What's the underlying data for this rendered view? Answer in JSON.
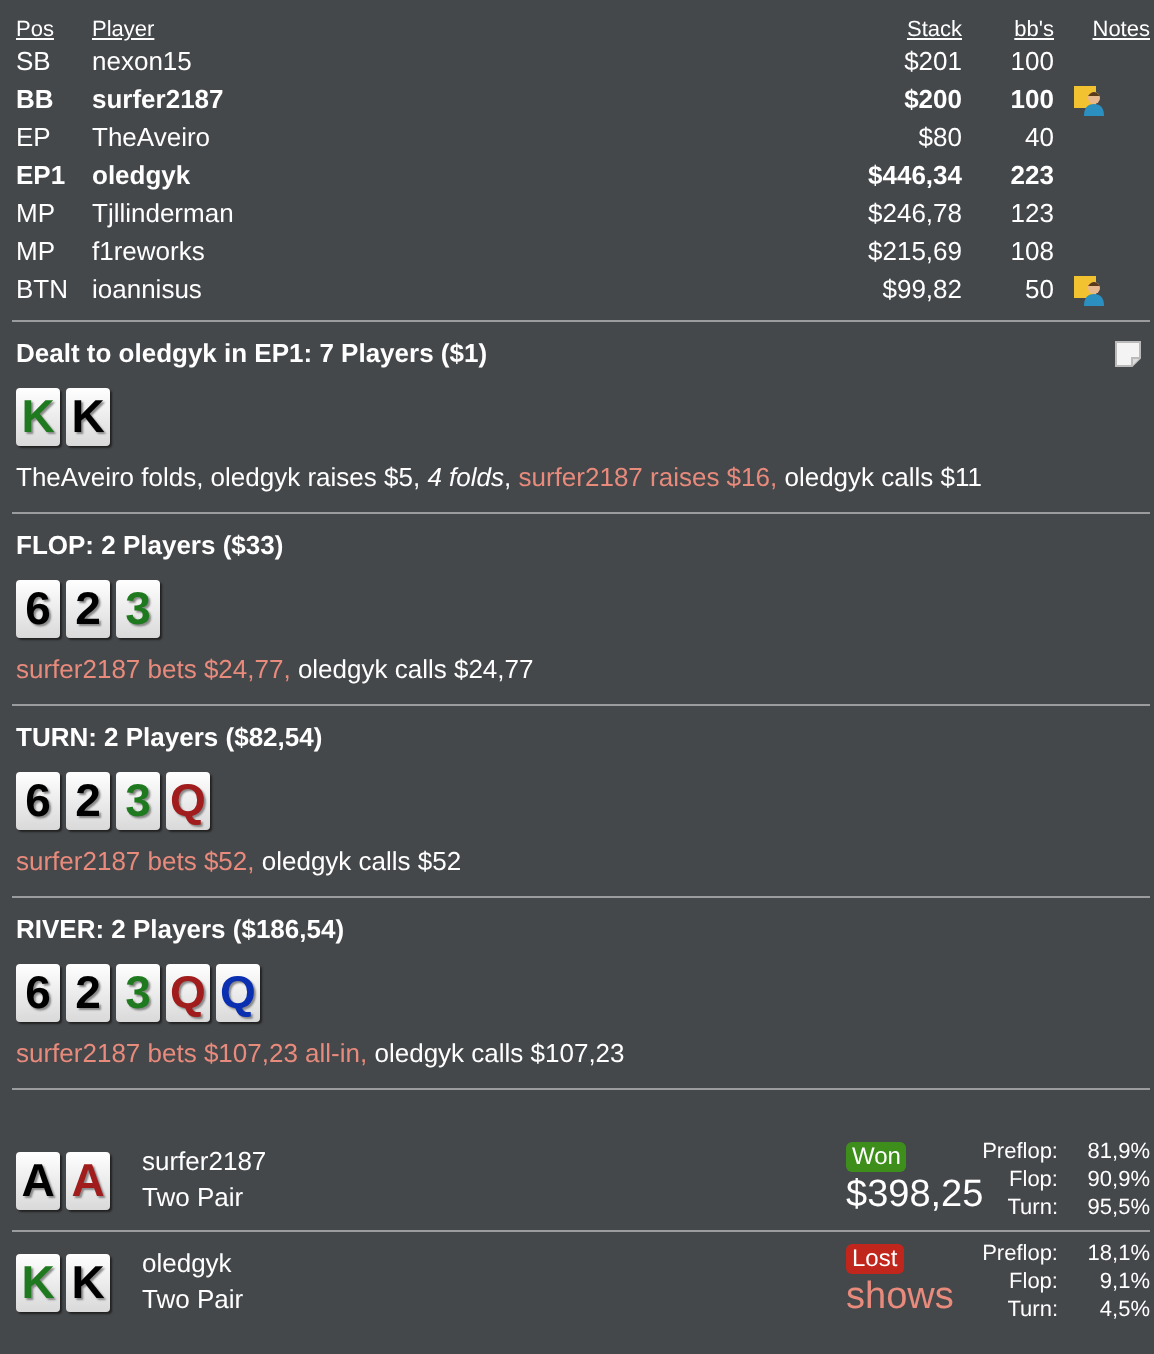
{
  "players": {
    "columns": [
      "Pos",
      "Player",
      "Stack",
      "bb's",
      "Notes"
    ],
    "rows": [
      {
        "pos": "SB",
        "name": "nexon15",
        "stack": "$201",
        "bbs": "100",
        "bold": false,
        "has_note": false
      },
      {
        "pos": "BB",
        "name": "surfer2187",
        "stack": "$200",
        "bbs": "100",
        "bold": true,
        "has_note": true
      },
      {
        "pos": "EP",
        "name": "TheAveiro",
        "stack": "$80",
        "bbs": "40",
        "bold": false,
        "has_note": false
      },
      {
        "pos": "EP1",
        "name": "oledgyk",
        "stack": "$446,34",
        "bbs": "223",
        "bold": true,
        "has_note": false
      },
      {
        "pos": "MP",
        "name": "Tjllinderman",
        "stack": "$246,78",
        "bbs": "123",
        "bold": false,
        "has_note": false
      },
      {
        "pos": "MP",
        "name": "f1reworks",
        "stack": "$215,69",
        "bbs": "108",
        "bold": false,
        "has_note": false
      },
      {
        "pos": "BTN",
        "name": "ioannisus",
        "stack": "$99,82",
        "bbs": "50",
        "bold": false,
        "has_note": true
      }
    ]
  },
  "streets": [
    {
      "title": "Dealt to oledgyk in EP1: 7 Players ($1)",
      "note": true,
      "cards": [
        {
          "rank": "K",
          "color": "#1f7a1f"
        },
        {
          "rank": "K",
          "color": "#000000"
        }
      ],
      "actions": [
        {
          "kind": "plain",
          "text": "TheAveiro folds, oledgyk raises $5, *4 folds*, "
        },
        {
          "kind": "villain",
          "text": "surfer2187 raises $16, "
        },
        {
          "kind": "plain",
          "text": "oledgyk calls $11"
        }
      ]
    },
    {
      "title": "FLOP: 2 Players ($33)",
      "note": false,
      "cards": [
        {
          "rank": "6",
          "color": "#000000"
        },
        {
          "rank": "2",
          "color": "#000000"
        },
        {
          "rank": "3",
          "color": "#1f7a1f"
        }
      ],
      "actions": [
        {
          "kind": "villain",
          "text": "surfer2187 bets $24,77, "
        },
        {
          "kind": "plain",
          "text": "oledgyk calls $24,77"
        }
      ]
    },
    {
      "title": "TURN: 2 Players ($82,54)",
      "note": false,
      "cards": [
        {
          "rank": "6",
          "color": "#000000"
        },
        {
          "rank": "2",
          "color": "#000000"
        },
        {
          "rank": "3",
          "color": "#1f7a1f"
        },
        {
          "rank": "Q",
          "color": "#a11c1c"
        }
      ],
      "actions": [
        {
          "kind": "villain",
          "text": "surfer2187 bets $52, "
        },
        {
          "kind": "plain",
          "text": "oledgyk calls $52"
        }
      ]
    },
    {
      "title": "RIVER: 2 Players ($186,54)",
      "note": false,
      "cards": [
        {
          "rank": "6",
          "color": "#000000"
        },
        {
          "rank": "2",
          "color": "#000000"
        },
        {
          "rank": "3",
          "color": "#1f7a1f"
        },
        {
          "rank": "Q",
          "color": "#a11c1c"
        },
        {
          "rank": "Q",
          "color": "#0a2fb0"
        }
      ],
      "actions": [
        {
          "kind": "villain",
          "text": "surfer2187 bets $107,23 all-in, "
        },
        {
          "kind": "plain",
          "text": "oledgyk calls $107,23"
        }
      ]
    }
  ],
  "showdown": [
    {
      "cards": [
        {
          "rank": "A",
          "color": "#000000"
        },
        {
          "rank": "A",
          "color": "#a11c1c"
        }
      ],
      "name": "surfer2187",
      "hand": "Two Pair",
      "won": true,
      "badge": "Won",
      "amount": "$398,25",
      "equity": [
        {
          "label": "Preflop:",
          "value": "81,9%"
        },
        {
          "label": "Flop:",
          "value": "90,9%"
        },
        {
          "label": "Turn:",
          "value": "95,5%"
        }
      ]
    },
    {
      "cards": [
        {
          "rank": "K",
          "color": "#1f7a1f"
        },
        {
          "rank": "K",
          "color": "#000000"
        }
      ],
      "name": "oledgyk",
      "hand": "Two Pair",
      "won": false,
      "badge": "Lost",
      "amount": "shows",
      "equity": [
        {
          "label": "Preflop:",
          "value": "18,1%"
        },
        {
          "label": "Flop:",
          "value": "9,1%"
        },
        {
          "label": "Turn:",
          "value": "4,5%"
        }
      ]
    }
  ]
}
